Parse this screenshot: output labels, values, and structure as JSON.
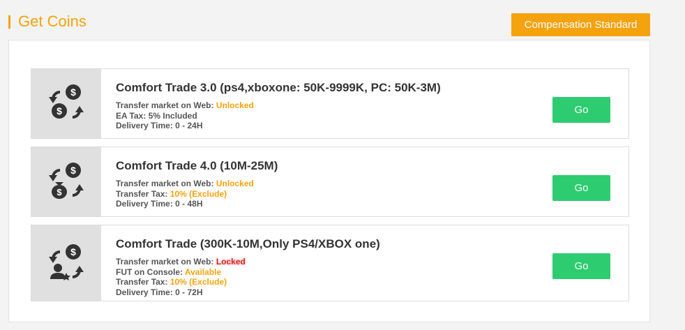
{
  "header": {
    "title": "Get Coins",
    "compensation_button": "Compensation Standard"
  },
  "colors": {
    "accent": "#f5a20f",
    "go_button": "#2ecc71",
    "locked": "#e02424"
  },
  "cards": [
    {
      "icon": "coin-exchange-icon",
      "title": "Comfort Trade 3.0 (ps4,xboxone: 50K-9999K, PC: 50K-3M)",
      "lines": [
        {
          "label": "Transfer market on Web: ",
          "value": "Unlocked"
        },
        {
          "label": "EA Tax: 5% Included"
        },
        {
          "label": "Delivery Time: 0 - 24H"
        }
      ],
      "button": "Go"
    },
    {
      "icon": "money-bag-exchange-icon",
      "title": "Comfort Trade 4.0 (10M-25M)",
      "lines": [
        {
          "label": "Transfer market on Web: ",
          "value": "Unlocked"
        },
        {
          "label": "Transfer Tax: ",
          "value": "10% (Exclude)"
        },
        {
          "label": "Delivery Time: 0 - 48H"
        }
      ],
      "button": "Go"
    },
    {
      "icon": "user-star-exchange-icon",
      "title": "Comfort Trade (300K-10M,Only PS4/XBOX one)",
      "lines": [
        {
          "label": "Transfer market on Web: ",
          "value": "Locked"
        },
        {
          "label": "FUT on Console: ",
          "value": "Available"
        },
        {
          "label": "Transfer Tax: ",
          "value": "10% (Exclude)"
        },
        {
          "label": "Delivery Time: 0 - 72H"
        }
      ],
      "button": "Go"
    }
  ]
}
